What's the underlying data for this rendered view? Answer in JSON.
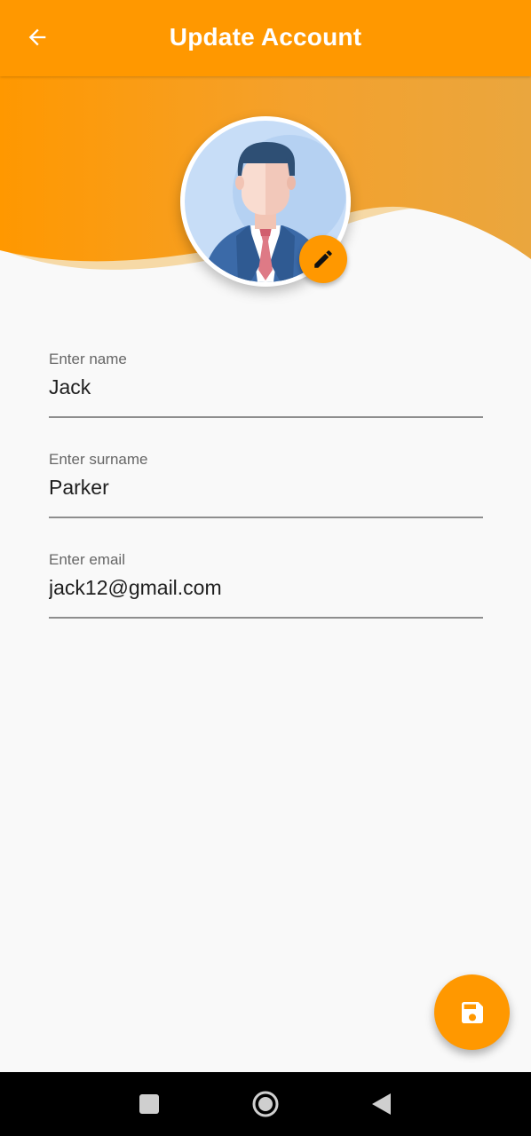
{
  "app_bar": {
    "title": "Update Account",
    "background_color": "#ff9800",
    "back_icon": "arrow-left-icon"
  },
  "profile": {
    "avatar_icon": "businessman-avatar-icon",
    "edit_icon": "pencil-icon",
    "accent_color": "#ff9800"
  },
  "form": {
    "fields": [
      {
        "label": "Enter name",
        "value": "Jack"
      },
      {
        "label": "Enter surname",
        "value": "Parker"
      },
      {
        "label": "Enter email",
        "value": "jack12@gmail.com"
      }
    ]
  },
  "fab": {
    "icon": "save-icon",
    "color": "#ff9800"
  },
  "system_nav": {
    "buttons": [
      "recents-square-icon",
      "home-circle-icon",
      "back-triangle-icon"
    ]
  }
}
